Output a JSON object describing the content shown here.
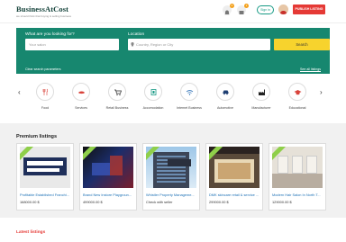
{
  "header": {
    "logo_name": "BusinessAtCost",
    "logo_tagline": "we should think that buying & selling business",
    "notif_count": "0",
    "msg_count": "1",
    "signin_label": "Sign in",
    "publish_label": "PUBLISH LISTING"
  },
  "search": {
    "what_label": "What are you looking for?",
    "what_placeholder": "Your salon",
    "location_label": "Location",
    "location_placeholder": "Country, Region or City",
    "search_button": "Search",
    "clear_label": "Clear search parameters",
    "see_all_label": "See all listings"
  },
  "categories": [
    {
      "label": "Food",
      "icon": "food-icon"
    },
    {
      "label": "Services",
      "icon": "services-icon"
    },
    {
      "label": "Retail Business",
      "icon": "retail-icon"
    },
    {
      "label": "Accomodation",
      "icon": "accomodation-icon"
    },
    {
      "label": "Internet Business",
      "icon": "wifi-icon"
    },
    {
      "label": "Automotive",
      "icon": "car-icon"
    },
    {
      "label": "Manufacturer",
      "icon": "factory-icon"
    },
    {
      "label": "Educational",
      "icon": "graduation-icon"
    }
  ],
  "premium": {
    "title": "Premium listings",
    "listings": [
      {
        "title": "Profitable Established Franchi...",
        "price": "168000.00 $"
      },
      {
        "title": "Brand New Instore Playgroun...",
        "price": "499000.00 $"
      },
      {
        "title": "Whistler Property Manageme...",
        "price": "Check with seller"
      },
      {
        "title": "DMK skincare retail & service ...",
        "price": "299000.00 $"
      },
      {
        "title": "Modern Hair Salon In North T...",
        "price": "129000.00 $"
      }
    ]
  },
  "latest": {
    "title": "Latest listings"
  },
  "colors": {
    "brand_green": "#17876f",
    "accent_red": "#e53935",
    "search_yellow": "#f7d32d"
  }
}
